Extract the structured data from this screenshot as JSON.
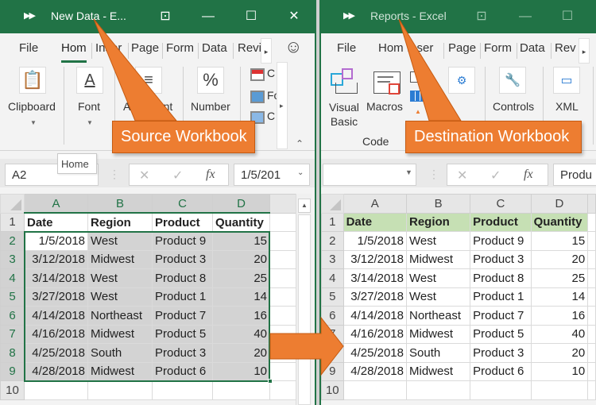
{
  "left_window": {
    "title": "New Data  -  E...",
    "qat_icon": "double-arrow-icon",
    "controls": {
      "restore": "ribbon-display-icon",
      "minimize": "minimize-icon",
      "maximize": "maximize-icon",
      "close": "close-icon"
    },
    "tabs": [
      "File",
      "Hom",
      "Inser",
      "Page",
      "Form",
      "Data",
      "Revi"
    ],
    "active_tab": "Hom",
    "feedback_icon": "smiley-icon",
    "ribbon_groups": [
      {
        "label": "Clipboard",
        "icon": "clipboard-icon"
      },
      {
        "label": "Font",
        "icon": "font-color-icon"
      },
      {
        "label": "Alignment",
        "icon": "align-icon"
      },
      {
        "label": "Number",
        "icon": "percent-icon"
      }
    ],
    "styles_items": [
      "C",
      "Fo",
      "C"
    ],
    "tooltip": "Home",
    "name_box": "A2",
    "formula_value": "1/5/201",
    "col_headers": [
      "A",
      "B",
      "C",
      "D"
    ],
    "row_numbers": [
      "1",
      "2",
      "3",
      "4",
      "5",
      "6",
      "7",
      "8",
      "9",
      "10"
    ]
  },
  "right_window": {
    "title": "Reports  -  Excel",
    "qat_icon": "double-arrow-icon",
    "tabs": [
      "File",
      "Hom",
      "Inser",
      "Page",
      "Form",
      "Data",
      "Rev"
    ],
    "ribbon_groups": [
      {
        "label": "Visual\nBasic",
        "label_line1": "Visual",
        "label_line2": "Basic",
        "icon": "visual-basic-icon"
      },
      {
        "label": "Macros",
        "icon": "macros-icon"
      },
      {
        "label": "Controls",
        "icon": "controls-icon"
      },
      {
        "label": "XML",
        "icon": "xml-icon"
      }
    ],
    "code_group_label": "Code",
    "name_box": "",
    "formula_value": "Produ",
    "col_headers": [
      "A",
      "B",
      "C",
      "D"
    ],
    "row_numbers": [
      "1",
      "2",
      "3",
      "4",
      "5",
      "6",
      "7",
      "8",
      "9",
      "10"
    ]
  },
  "table": {
    "headers": [
      "Date",
      "Region",
      "Product",
      "Quantity"
    ],
    "rows": [
      [
        "1/5/2018",
        "West",
        "Product 9",
        "15"
      ],
      [
        "3/12/2018",
        "Midwest",
        "Product 3",
        "20"
      ],
      [
        "3/14/2018",
        "West",
        "Product 8",
        "25"
      ],
      [
        "3/27/2018",
        "West",
        "Product 1",
        "14"
      ],
      [
        "4/14/2018",
        "Northeast",
        "Product 7",
        "16"
      ],
      [
        "4/16/2018",
        "Midwest",
        "Product 5",
        "40"
      ],
      [
        "4/25/2018",
        "South",
        "Product 3",
        "20"
      ],
      [
        "4/28/2018",
        "Midwest",
        "Product 6",
        "10"
      ]
    ]
  },
  "callouts": {
    "source": "Source Workbook",
    "destination": "Destination Workbook"
  },
  "colors": {
    "excel_green": "#217346",
    "callout_orange": "#ed7d31",
    "header_fill": "#c6e0b4",
    "selection_gray": "#d3d3d3"
  }
}
